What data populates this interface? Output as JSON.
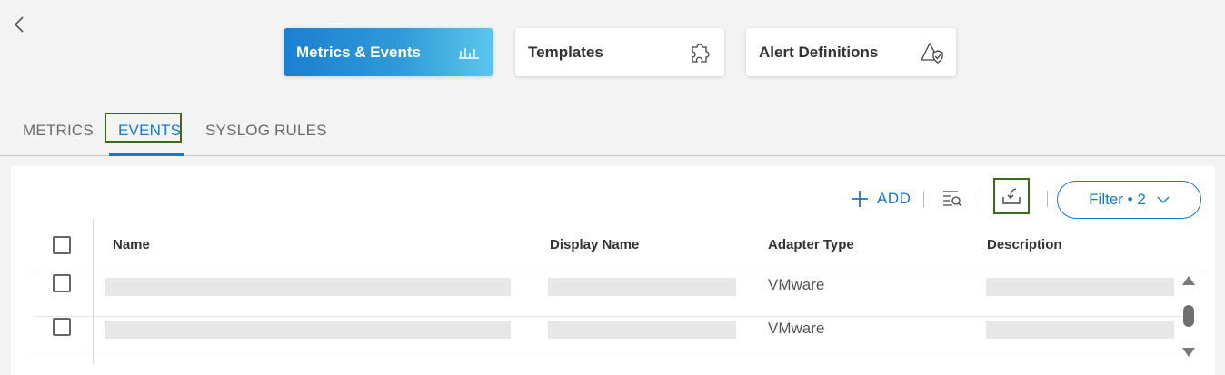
{
  "nav": {
    "back_icon": "chevron-left-icon"
  },
  "cards": {
    "metrics": {
      "label": "Metrics & Events",
      "icon": "bar-chart-icon",
      "active": true
    },
    "templates": {
      "label": "Templates",
      "icon": "puzzle-icon"
    },
    "alerts": {
      "label": "Alert Definitions",
      "icon": "alert-shield-icon"
    }
  },
  "tabs": [
    {
      "label": "METRICS",
      "active": false
    },
    {
      "label": "EVENTS",
      "active": true
    },
    {
      "label": "SYSLOG RULES",
      "active": false
    }
  ],
  "toolbar": {
    "add_label": "ADD",
    "filter_label": "Filter • 2",
    "search_icon": "list-search-icon",
    "export_icon": "export-icon",
    "chevron_icon": "chevron-down-icon"
  },
  "table": {
    "headers": [
      "Name",
      "Display Name",
      "Adapter Type",
      "Description"
    ],
    "rows": [
      {
        "adapter_type": "VMware"
      },
      {
        "adapter_type": "VMware"
      }
    ]
  },
  "colors": {
    "accent": "#1a78c4",
    "highlight_border": "#3a6a1a",
    "active_card_start": "#1b7fd0",
    "active_card_end": "#5cc6ee"
  }
}
